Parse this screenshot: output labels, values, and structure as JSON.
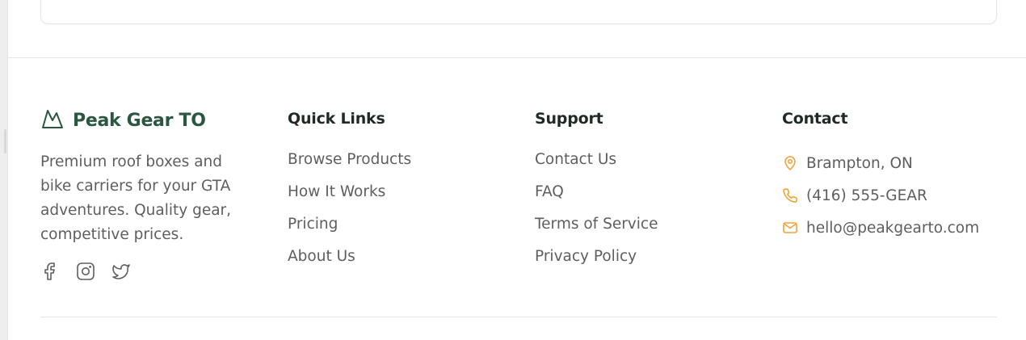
{
  "brand": {
    "name": "Peak Gear TO",
    "tagline": "Premium roof boxes and bike carriers for your GTA adventures. Quality gear, competitive prices.",
    "logo_icon": "mountain-icon",
    "brand_color": "#2b5640"
  },
  "socials": [
    {
      "icon": "facebook-icon"
    },
    {
      "icon": "instagram-icon"
    },
    {
      "icon": "twitter-icon"
    }
  ],
  "quick_links": {
    "title": "Quick Links",
    "items": [
      {
        "label": "Browse Products"
      },
      {
        "label": "How It Works"
      },
      {
        "label": "Pricing"
      },
      {
        "label": "About Us"
      }
    ]
  },
  "support": {
    "title": "Support",
    "items": [
      {
        "label": "Contact Us"
      },
      {
        "label": "FAQ"
      },
      {
        "label": "Terms of Service"
      },
      {
        "label": "Privacy Policy"
      }
    ]
  },
  "contact": {
    "title": "Contact",
    "accent_color": "#f2a33a",
    "items": [
      {
        "icon": "map-pin-icon",
        "text": "Brampton, ON"
      },
      {
        "icon": "phone-icon",
        "text": "(416) 555-GEAR"
      },
      {
        "icon": "mail-icon",
        "text": "hello@peakgearto.com"
      }
    ]
  }
}
